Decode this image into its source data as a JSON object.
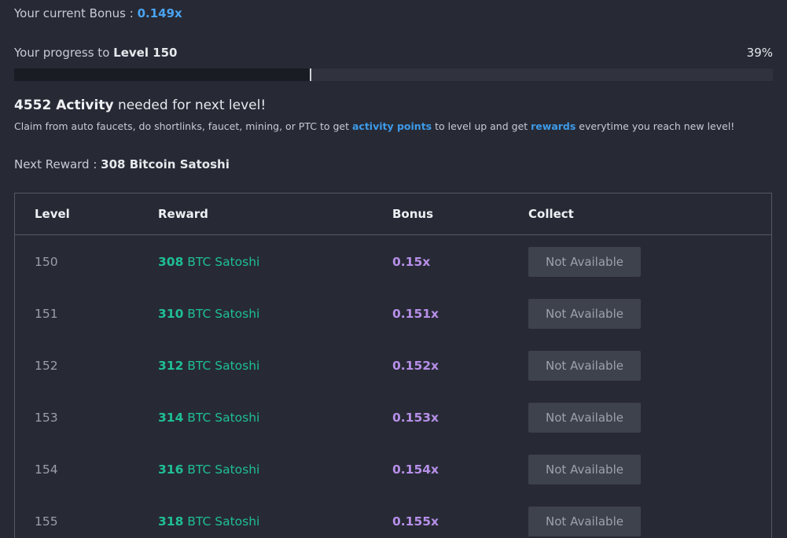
{
  "bonus": {
    "label": "Your current Bonus : ",
    "value": "0.149x"
  },
  "progress": {
    "label_prefix": "Your progress to ",
    "target_level": "Level 150",
    "percent_text": "39%",
    "fraction": 0.39
  },
  "activity": {
    "amount": "4552 Activity",
    "suffix": " needed for next level!",
    "desc_part1": "Claim from auto faucets, do shortlinks, faucet, mining, or PTC to get ",
    "desc_link1": "activity points",
    "desc_part2": " to level up and get ",
    "desc_link2": "rewards",
    "desc_part3": " everytime you reach new level!"
  },
  "next_reward": {
    "label": "Next Reward : ",
    "value": "308 Bitcoin Satoshi"
  },
  "table": {
    "headers": {
      "level": "Level",
      "reward": "Reward",
      "bonus": "Bonus",
      "collect": "Collect"
    },
    "rows": [
      {
        "level": "150",
        "reward_amount": "308",
        "reward_unit": " BTC Satoshi",
        "bonus": "0.15x",
        "collect": "Not Available"
      },
      {
        "level": "151",
        "reward_amount": "310",
        "reward_unit": " BTC Satoshi",
        "bonus": "0.151x",
        "collect": "Not Available"
      },
      {
        "level": "152",
        "reward_amount": "312",
        "reward_unit": " BTC Satoshi",
        "bonus": "0.152x",
        "collect": "Not Available"
      },
      {
        "level": "153",
        "reward_amount": "314",
        "reward_unit": " BTC Satoshi",
        "bonus": "0.153x",
        "collect": "Not Available"
      },
      {
        "level": "154",
        "reward_amount": "316",
        "reward_unit": " BTC Satoshi",
        "bonus": "0.154x",
        "collect": "Not Available"
      },
      {
        "level": "155",
        "reward_amount": "318",
        "reward_unit": " BTC Satoshi",
        "bonus": "0.155x",
        "collect": "Not Available"
      }
    ]
  },
  "colors": {
    "background": "#272a35",
    "accent_blue": "#4aa3f0",
    "reward_green": "#1fbf93",
    "bonus_purple": "#b68fe8",
    "button_bg": "#3e424d"
  }
}
